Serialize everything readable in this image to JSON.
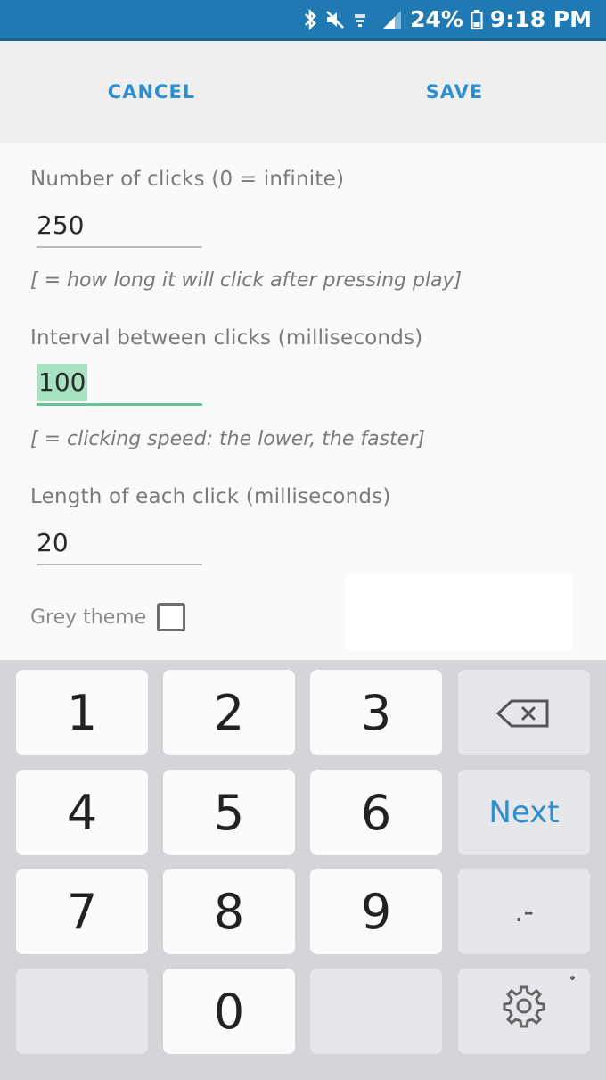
{
  "status_bar": {
    "battery": "24%",
    "time": "9:18 PM",
    "icons": [
      "bluetooth-icon",
      "mute-icon",
      "wifi-icon",
      "signal-icon",
      "battery-icon"
    ]
  },
  "action_bar": {
    "cancel_label": "CANCEL",
    "save_label": "SAVE"
  },
  "form": {
    "clicks_label": "Number of clicks (0 = infinite)",
    "clicks_value": "250",
    "clicks_hint": "[ = how long it will click after pressing play]",
    "interval_label": "Interval between clicks (milliseconds)",
    "interval_value": "100",
    "interval_hint": "[ = clicking speed: the lower, the faster]",
    "length_label": "Length of each click (milliseconds)",
    "length_value": "20",
    "grey_theme_label": "Grey theme"
  },
  "keyboard": {
    "keys": [
      "1",
      "2",
      "3",
      "4",
      "5",
      "6",
      "7",
      "8",
      "9",
      "0"
    ],
    "next_label": "Next",
    "punct_label": ".-",
    "backspace_icon": "backspace-icon",
    "settings_icon": "gear-icon"
  },
  "colors": {
    "status_bar": "#1f7ab3",
    "accent": "#2e8fd0",
    "focus_underline": "#67c496",
    "selection": "#a9e2c3"
  }
}
